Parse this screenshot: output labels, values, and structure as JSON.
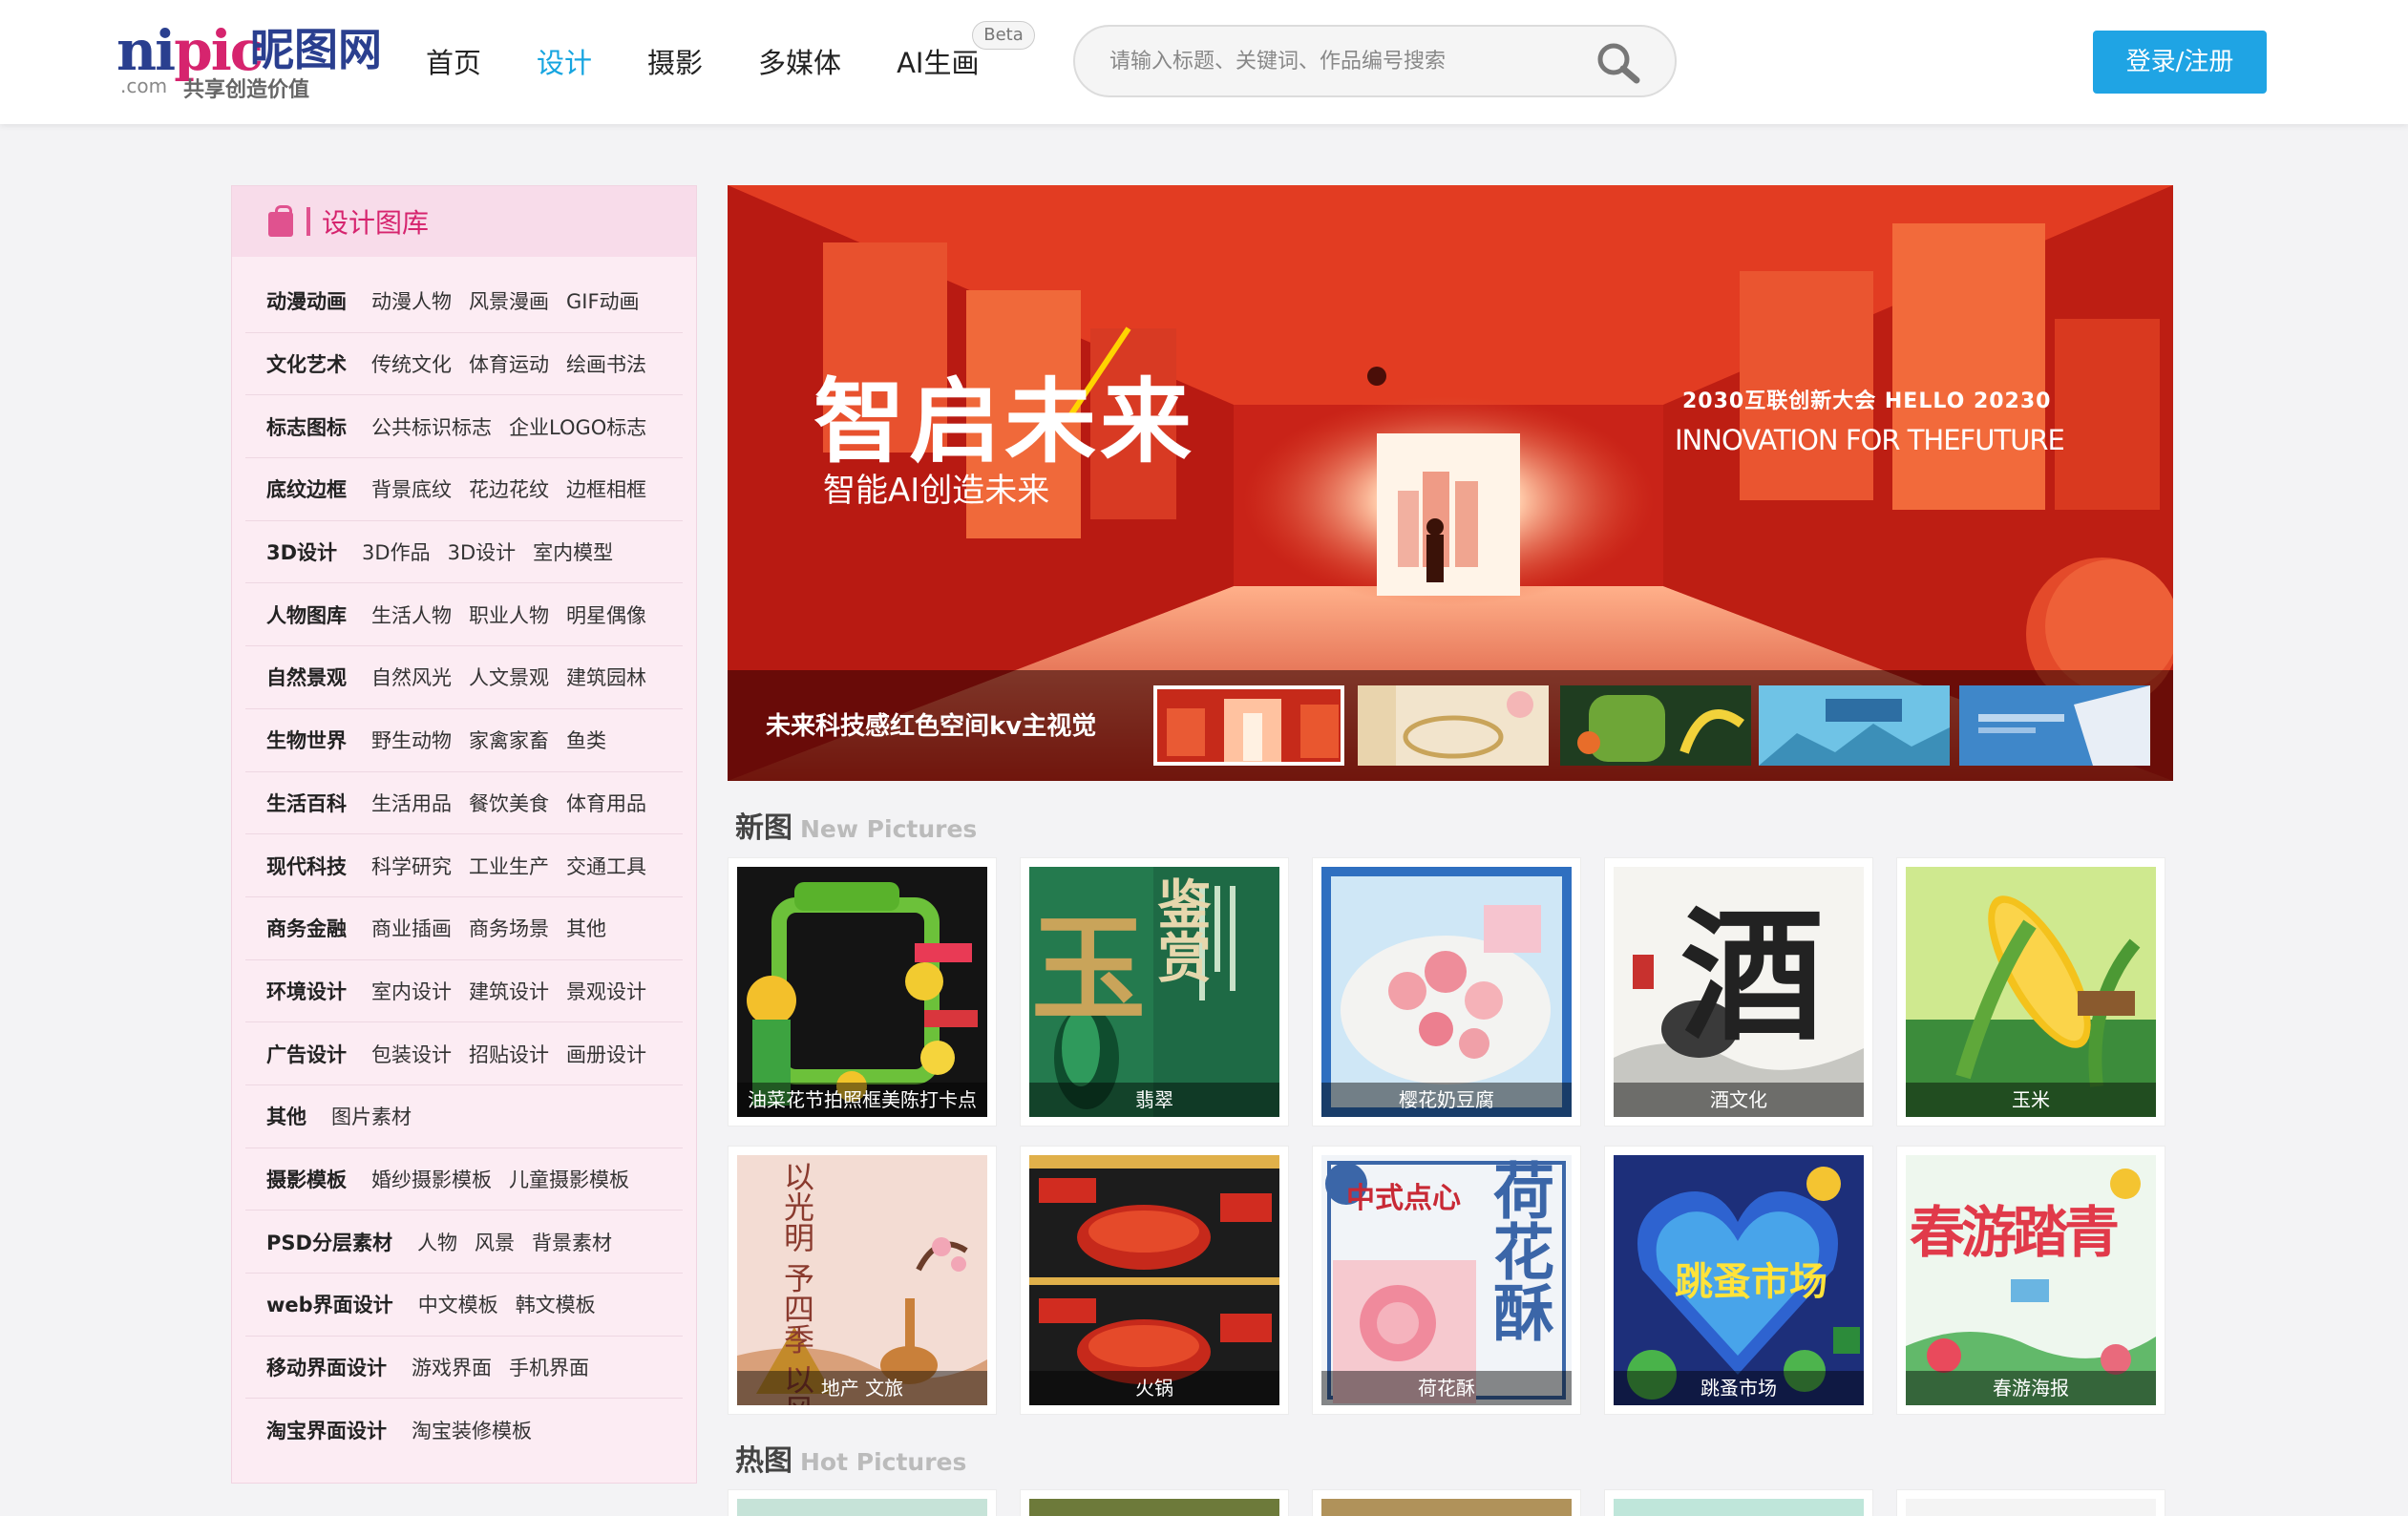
{
  "header": {
    "logo_en_1": "ni",
    "logo_en_2": "pic",
    "logo_cn": "昵图网",
    "logo_com": ".com",
    "logo_slogan": "共享创造价值",
    "nav": [
      "首页",
      "设计",
      "摄影",
      "多媒体",
      "AI生画"
    ],
    "beta": "Beta",
    "search_placeholder": "请输入标题、关键词、作品编号搜索",
    "login": "登录/注册",
    "accent_color": "#16a5e0"
  },
  "sidebar": {
    "title": "设计图库",
    "rows": [
      {
        "cat": "动漫动画",
        "subs": [
          "动漫人物",
          "风景漫画",
          "GIF动画"
        ]
      },
      {
        "cat": "文化艺术",
        "subs": [
          "传统文化",
          "体育运动",
          "绘画书法"
        ]
      },
      {
        "cat": "标志图标",
        "subs": [
          "公共标识标志",
          "企业LOGO标志"
        ]
      },
      {
        "cat": "底纹边框",
        "subs": [
          "背景底纹",
          "花边花纹",
          "边框相框"
        ]
      },
      {
        "cat": "3D设计",
        "subs": [
          "3D作品",
          "3D设计",
          "室内模型"
        ]
      },
      {
        "cat": "人物图库",
        "subs": [
          "生活人物",
          "职业人物",
          "明星偶像"
        ]
      },
      {
        "cat": "自然景观",
        "subs": [
          "自然风光",
          "人文景观",
          "建筑园林"
        ]
      },
      {
        "cat": "生物世界",
        "subs": [
          "野生动物",
          "家禽家畜",
          "鱼类"
        ]
      },
      {
        "cat": "生活百科",
        "subs": [
          "生活用品",
          "餐饮美食",
          "体育用品"
        ]
      },
      {
        "cat": "现代科技",
        "subs": [
          "科学研究",
          "工业生产",
          "交通工具"
        ]
      },
      {
        "cat": "商务金融",
        "subs": [
          "商业插画",
          "商务场景",
          "其他"
        ]
      },
      {
        "cat": "环境设计",
        "subs": [
          "室内设计",
          "建筑设计",
          "景观设计"
        ]
      },
      {
        "cat": "广告设计",
        "subs": [
          "包装设计",
          "招贴设计",
          "画册设计"
        ]
      },
      {
        "cat": "其他",
        "subs": [
          "图片素材"
        ]
      },
      {
        "cat": "摄影模板",
        "subs": [
          "婚纱摄影模板",
          "儿童摄影模板"
        ]
      },
      {
        "cat": "PSD分层素材",
        "subs": [
          "人物",
          "风景",
          "背景素材"
        ]
      },
      {
        "cat": "web界面设计",
        "subs": [
          "中文模板",
          "韩文模板"
        ]
      },
      {
        "cat": "移动界面设计",
        "subs": [
          "游戏界面",
          "手机界面"
        ]
      },
      {
        "cat": "淘宝界面设计",
        "subs": [
          "淘宝装修模板"
        ]
      }
    ]
  },
  "banner": {
    "title": "智启未来",
    "subtitle": "智能AI创造未来",
    "right_line1": "2030互联创新大会   HELLO 20230",
    "right_line2": "INNOVATION FOR THEFUTURE",
    "caption": "未来科技感红色空间kv主视觉"
  },
  "new_section": {
    "title_cn": "新图",
    "title_en": "New Pictures",
    "cards": [
      "油菜花节拍照框美陈打卡点",
      "翡翠",
      "樱花奶豆腐",
      "酒文化",
      "玉米",
      "地产 文旅",
      "火锅",
      "荷花酥",
      "跳蚤市场",
      "春游海报"
    ]
  },
  "art_text": {
    "jade_big": "玉",
    "jade_small": "鉴赏",
    "wine_big": "酒",
    "lotus_big": "荷花酥",
    "lotus_small": "中式点心",
    "flea_big": "跳蚤市场",
    "spring_big": "春游踏青",
    "estate_text": "以光明 予四季 以风景 予茶汤"
  },
  "hot_section": {
    "title_cn": "热图",
    "title_en": "Hot Pictures"
  }
}
